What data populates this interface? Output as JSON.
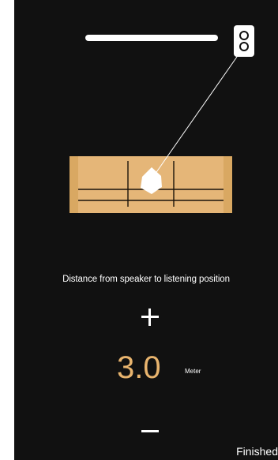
{
  "instruction": {
    "label": "Distance from speaker to listening position"
  },
  "distance": {
    "value": "3.0",
    "unit": "Meter"
  },
  "controls": {
    "increase_icon": "plus-icon",
    "decrease_icon": "minus-icon"
  },
  "footer": {
    "finished_label": "Finished"
  },
  "scene": {
    "tv_icon": "tv-icon",
    "speaker_icon": "speaker-icon",
    "sofa_icon": "sofa-icon",
    "listener_icon": "listener-position-icon"
  },
  "colors": {
    "background": "#111111",
    "accent": "#e8b46e",
    "sofa_light": "#e5b678",
    "sofa_dark": "#d9a862",
    "text": "#ffffff"
  }
}
